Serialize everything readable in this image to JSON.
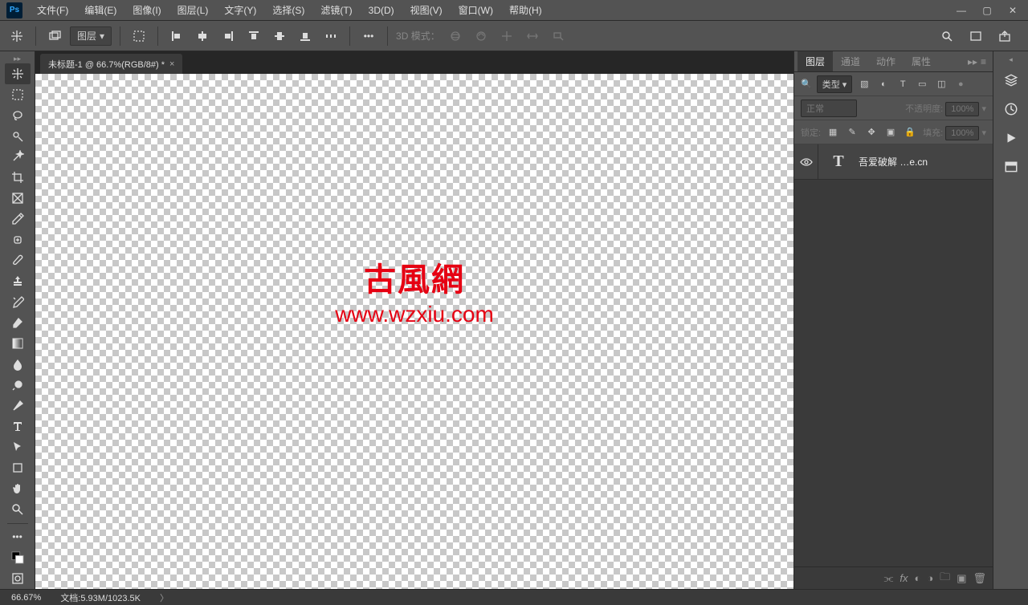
{
  "menu": {
    "items": [
      "文件(F)",
      "编辑(E)",
      "图像(I)",
      "图层(L)",
      "文字(Y)",
      "选择(S)",
      "滤镜(T)",
      "3D(D)",
      "视图(V)",
      "窗口(W)",
      "帮助(H)"
    ]
  },
  "options": {
    "layer_dd": "图层",
    "mode_label": "3D 模式："
  },
  "doc_tab": {
    "title": "未标题-1 @ 66.7%(RGB/8#) *"
  },
  "watermark": {
    "logo": "古風網",
    "url": "www.wzxiu.com"
  },
  "panels": {
    "tabs": {
      "layers": "图层",
      "channels": "通道",
      "actions": "动作",
      "properties": "属性"
    },
    "search_label": "类型",
    "blend_mode": "正常",
    "opacity_label": "不透明度:",
    "opacity_value": "100%",
    "lock_label": "锁定:",
    "fill_label": "填充:",
    "fill_value": "100%"
  },
  "layer": {
    "name": "吾爱破解 …e.cn"
  },
  "status": {
    "zoom": "66.67%",
    "doc_label": "文档:",
    "doc_info": "5.93M/1023.5K"
  }
}
